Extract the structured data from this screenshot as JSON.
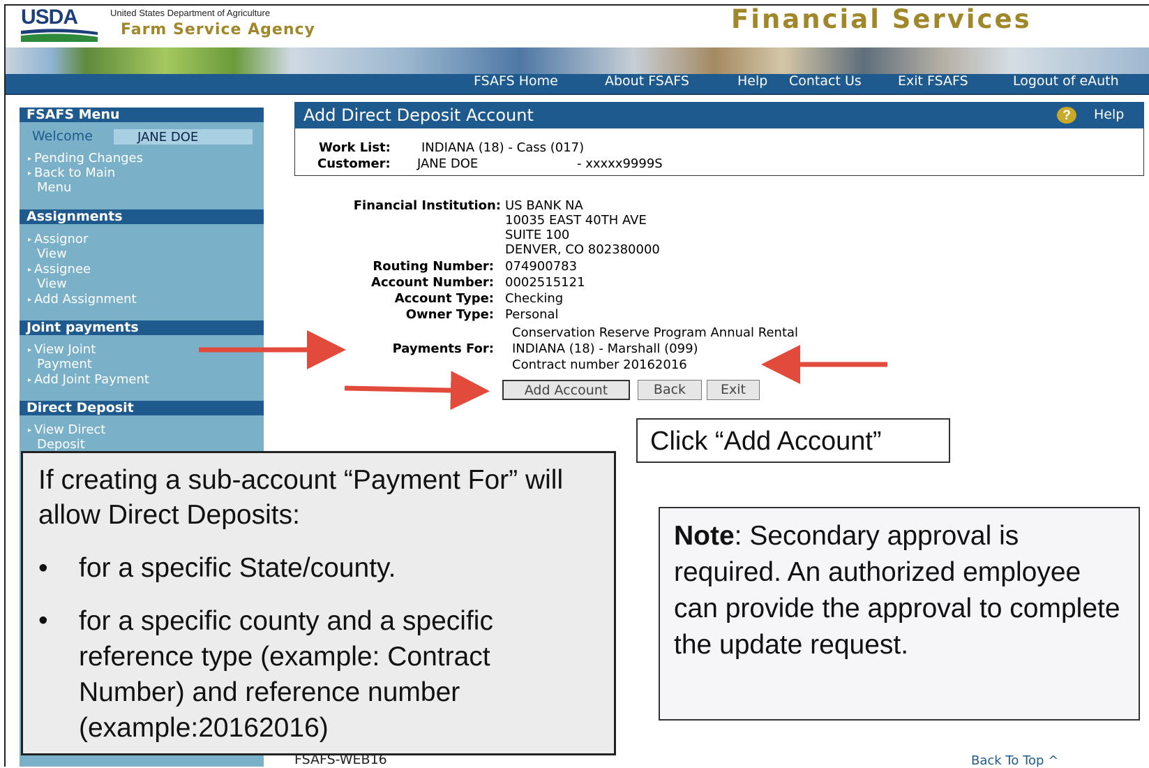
{
  "header": {
    "logo_text": "USDA",
    "department": "United States Department of Agriculture",
    "agency": "Farm Service Agency",
    "site_title": "Financial Services"
  },
  "nav": {
    "links": [
      "FSAFS Home",
      "About FSAFS",
      "Help",
      "Contact Us",
      "Exit FSAFS",
      "Logout of eAuth"
    ]
  },
  "sidebar": {
    "menu_title": "FSAFS Menu",
    "welcome_label": "Welcome",
    "user_name": "JANE DOE",
    "menu_items": [
      "Pending Changes",
      "Back to Main",
      "Menu"
    ],
    "assignments_title": "Assignments",
    "assignments_items": [
      "Assignor",
      "View",
      "Assignee",
      "View",
      "Add Assignment"
    ],
    "joint_title": "Joint payments",
    "joint_items": [
      "View Joint",
      "Payment",
      "Add Joint Payment"
    ],
    "deposit_title": "Direct Deposit",
    "deposit_items": [
      "View Direct",
      "Deposit"
    ]
  },
  "main": {
    "title": "Add Direct Deposit Account",
    "help_label": "Help",
    "help_icon": "question-circle-icon",
    "work_list_label": "Work List:",
    "work_list_value": "INDIANA (18) - Cass (017)",
    "customer_label": "Customer:",
    "customer_value": "JANE DOE",
    "customer_id": "- xxxxx9999S"
  },
  "details": {
    "fi_label": "Financial Institution:",
    "fi_lines": [
      "US BANK NA",
      "10035 EAST 40TH AVE",
      "SUITE 100",
      "DENVER, CO 802380000"
    ],
    "routing_label": "Routing Number:",
    "routing_value": "074900783",
    "account_label": "Account Number:",
    "account_value": "0002515121",
    "type_label": "Account Type:",
    "type_value": "Checking",
    "owner_label": "Owner Type:",
    "owner_value": "Personal",
    "payments_label": "Payments For:",
    "payments_lines": [
      "Conservation Reserve Program Annual Rental",
      "INDIANA (18) - Marshall (099)",
      "Contract number 20162016"
    ]
  },
  "buttons": {
    "add": "Add Account",
    "back": "Back",
    "exit": "Exit"
  },
  "callouts": {
    "click": "Click “Add Account”",
    "sub_intro": "If creating a sub-account “Payment For” will allow Direct Deposits:",
    "sub_bullets": [
      "for a specific State/county.",
      "for a specific county and a specific reference type (example: Contract Number) and reference number (example:20162016)"
    ],
    "note_bold": "Note",
    "note_text": ": Secondary approval is required.  An authorized employee can provide the approval to complete the update request."
  },
  "footer": {
    "code": "FSAFS-WEB16",
    "back_to_top": "Back To Top ^"
  },
  "colors": {
    "nav_blue": "#1f5a8e",
    "sidebar_blue": "#7ab0c8",
    "gold": "#a0882a",
    "arrow_red": "#e24b3b"
  }
}
